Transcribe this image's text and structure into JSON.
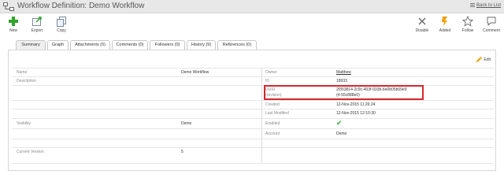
{
  "header": {
    "title": "Workflow Definition: Demo Workflow",
    "back_link": "Back to List"
  },
  "toolbar_left": [
    {
      "label": "New",
      "icon": "plus-icon"
    },
    {
      "label": "Export",
      "icon": "export-icon"
    },
    {
      "label": "Copy",
      "icon": "copy-icon"
    }
  ],
  "toolbar_right": [
    {
      "label": "Disable",
      "icon": "close-icon"
    },
    {
      "label": "Added",
      "icon": "added-icon"
    },
    {
      "label": "Follow",
      "icon": "star-icon"
    },
    {
      "label": "Comment",
      "icon": "comment-icon"
    }
  ],
  "tabs": [
    {
      "label": "Summary"
    },
    {
      "label": "Graph"
    },
    {
      "label": "Attachments (0)"
    },
    {
      "label": "Comments (0)"
    },
    {
      "label": "Followers (0)"
    },
    {
      "label": "History (9)"
    },
    {
      "label": "References (0)"
    }
  ],
  "edit_label": "Edit",
  "left_fields": {
    "name": {
      "label": "Name",
      "value": "Demo Workflow"
    },
    "description": {
      "label": "Description",
      "value": ""
    },
    "visibility": {
      "label": "Visibility",
      "value": "Demo"
    },
    "current_version": {
      "label": "Current Version",
      "value": "5"
    }
  },
  "right_fields": {
    "owner": {
      "label": "Owner",
      "value": "Matthew"
    },
    "id": {
      "label": "ID",
      "value": "18933"
    },
    "uuid": {
      "label": "UUID",
      "sublabel": "(revision)",
      "value": "2f353814-2c9c-403f-933b-be0b05b09e9",
      "subvalue": "(4-55c888e0)"
    },
    "created": {
      "label": "Created",
      "value": "12-Nov-2015 11:26:24"
    },
    "last_modified": {
      "label": "Last Modified",
      "value": "12-Nov-2015 12:10:30"
    },
    "enabled": {
      "label": "Enabled",
      "value": "✔"
    },
    "account": {
      "label": "Account",
      "value": "Demo"
    }
  },
  "colors": {
    "highlight": "#d9262c",
    "plus": "#2fa52a",
    "added": "#f0a000",
    "check": "#3aa53a"
  }
}
